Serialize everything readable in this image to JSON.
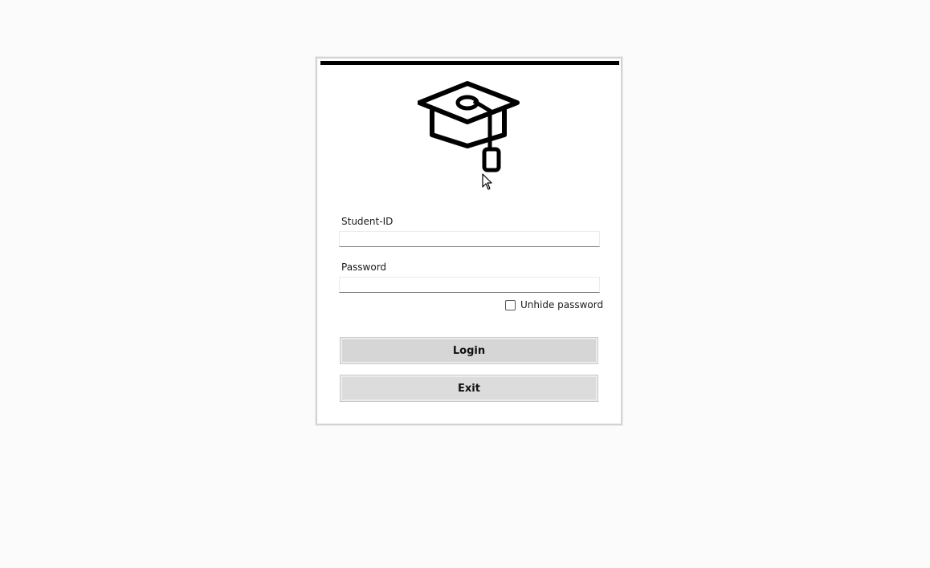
{
  "logo": {
    "icon": "graduation-cap-icon"
  },
  "student_id": {
    "label": "Student-ID",
    "value": ""
  },
  "password": {
    "label": "Password",
    "value": ""
  },
  "unhide": {
    "label": "Unhide password",
    "checked": false
  },
  "buttons": {
    "login": "Login",
    "exit": "Exit"
  },
  "colors": {
    "accent_bar": "#000000",
    "button_bg": "#d6d6d6",
    "page_bg": "#fbfbfb"
  }
}
